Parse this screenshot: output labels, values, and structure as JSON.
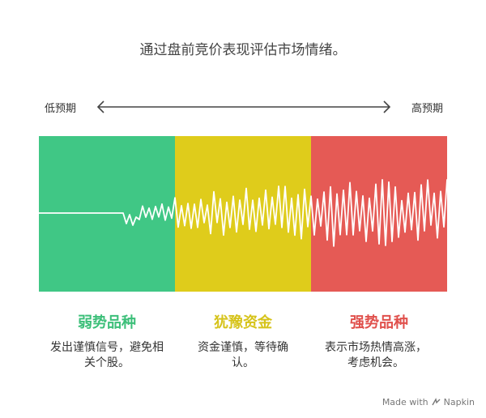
{
  "title": "通过盘前竞价表现评估市场情绪。",
  "axis": {
    "low_label": "低预期",
    "high_label": "高预期"
  },
  "columns": [
    {
      "title": "弱势品种",
      "description": "发出谨慎信号，避免相关个股。",
      "color": "#40c785",
      "title_color": "#3cbf79"
    },
    {
      "title": "犹豫资金",
      "description": "资金谨慎，等待确认。",
      "color": "#dfcc1b",
      "title_color": "#d6c31a"
    },
    {
      "title": "强势品种",
      "description": "表示市场热情高涨，考虑机会。",
      "color": "#e55a55",
      "title_color": "#e0504c"
    }
  ],
  "wave_color": "#ffffff",
  "footer": {
    "made_with": "Made with",
    "brand": "Napkin"
  }
}
